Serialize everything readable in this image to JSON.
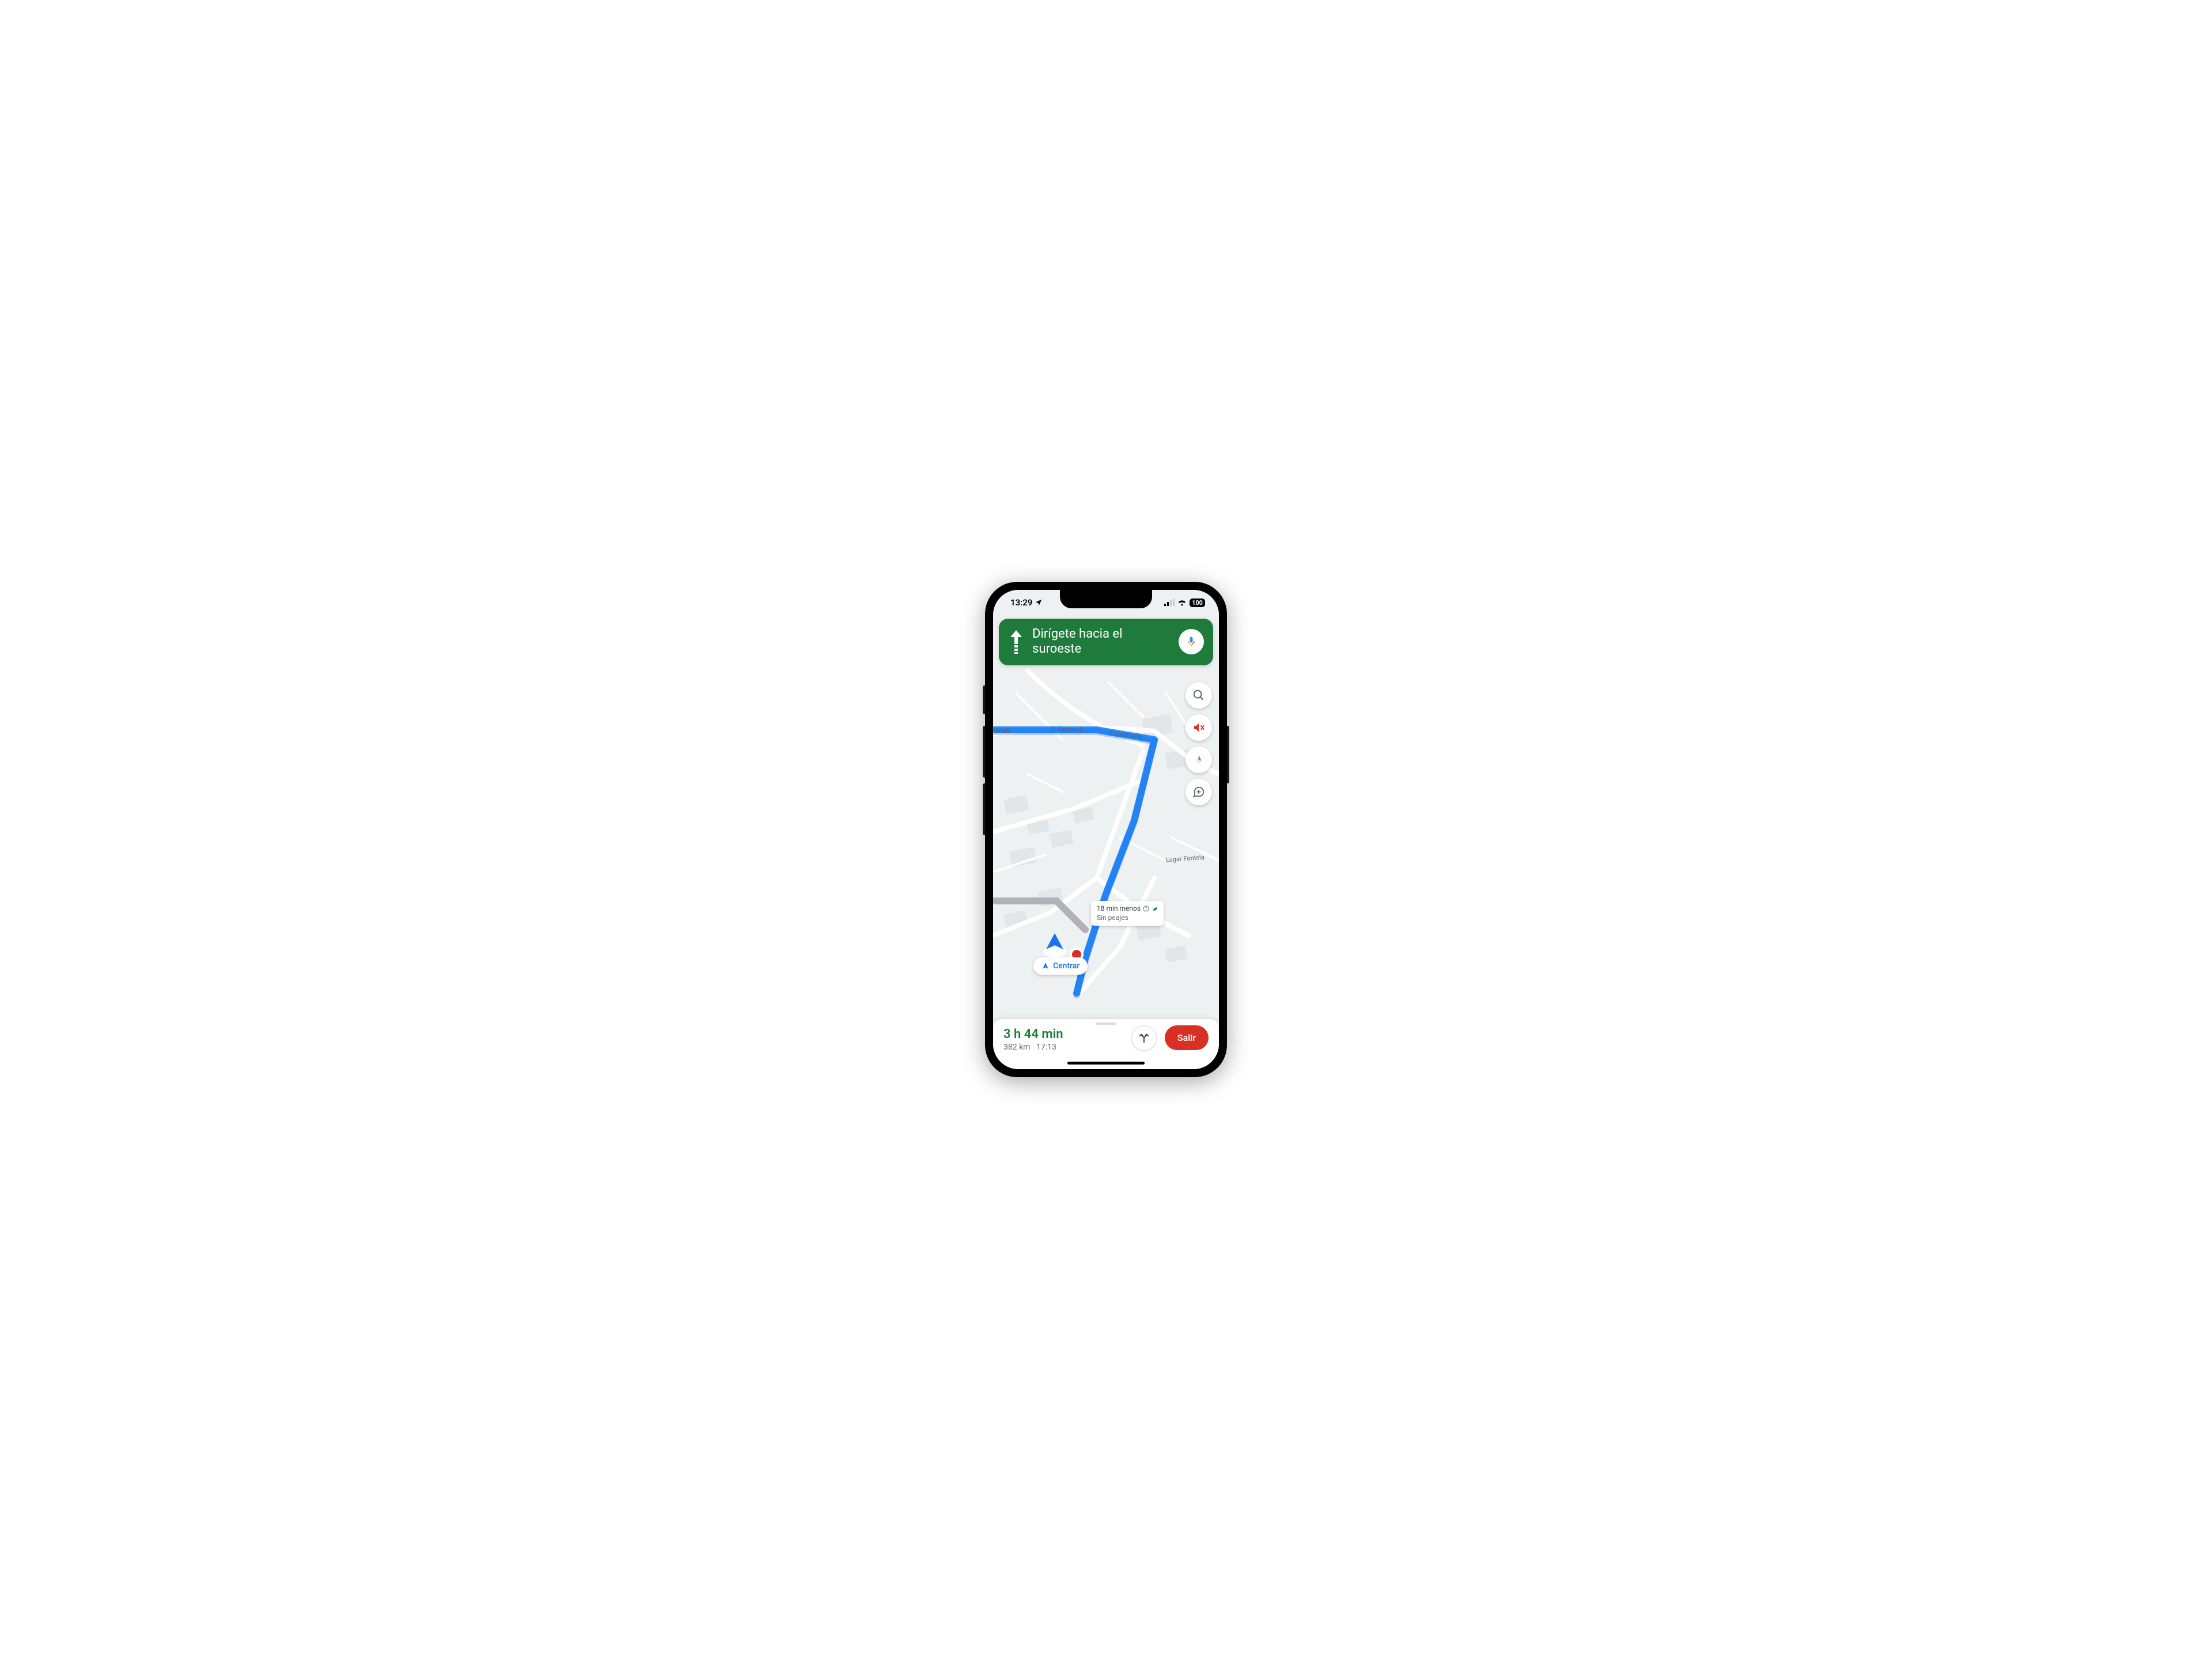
{
  "status": {
    "time": "13:29",
    "battery": "100"
  },
  "direction": {
    "instruction": "Dirígete hacia el suroeste"
  },
  "map": {
    "street_centinela_1": "tinela",
    "street_centinela_2": "C. Centinela",
    "street_centinela_3": "C. Centinela",
    "street_fontela": "Lugar Fontela"
  },
  "callout": {
    "line1": "18 min menos",
    "line2": "Sin peajes"
  },
  "recenter": {
    "label": "Centrar"
  },
  "bottom": {
    "eta_duration": "3 h 44 min",
    "distance_arrival": "382 km · 17:13",
    "exit_label": "Salir"
  }
}
